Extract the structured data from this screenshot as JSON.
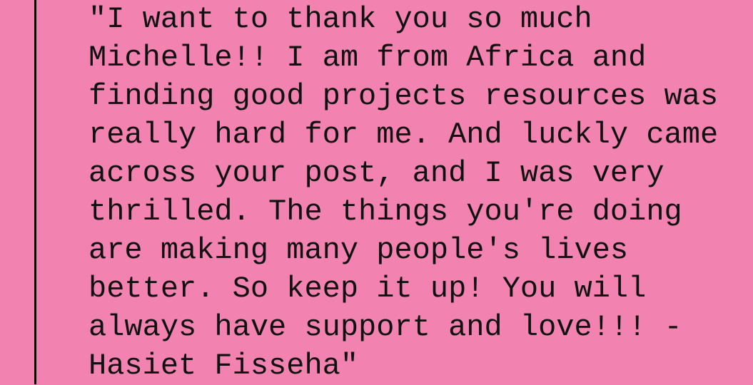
{
  "quote": {
    "lines": [
      "\"I want to thank you so much",
      "Michelle!! I am from Africa and",
      "finding good projects resources was",
      "really hard for me. And luckly came",
      "across your post, and I was very",
      "thrilled. The things you're doing",
      "are making many people's lives",
      "better. So keep it up! You will",
      "always have support and love!!! -",
      "Hasiet Fisseha\""
    ]
  },
  "colors": {
    "background": "#f283b0",
    "text": "#111111",
    "border": "#000000"
  }
}
